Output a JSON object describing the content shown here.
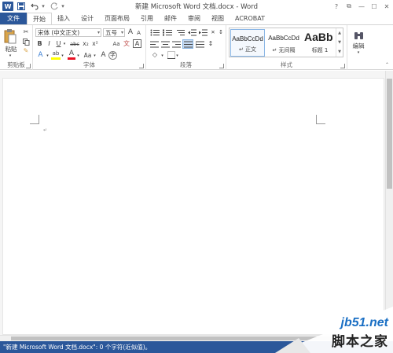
{
  "app": {
    "title": "新建 Microsoft Word 文档.docx - Word",
    "logo_letter": "W"
  },
  "quick_access": {
    "save_icon": "save-icon",
    "undo_icon": "undo-icon",
    "redo_icon": "redo-icon"
  },
  "window_controls": [
    "?",
    "⧉",
    "—",
    "☐",
    "✕"
  ],
  "tabs": [
    {
      "label": "文件"
    },
    {
      "label": "开始"
    },
    {
      "label": "插入"
    },
    {
      "label": "设计"
    },
    {
      "label": "页面布局"
    },
    {
      "label": "引用"
    },
    {
      "label": "邮件"
    },
    {
      "label": "审阅"
    },
    {
      "label": "视图"
    },
    {
      "label": "ACROBAT"
    }
  ],
  "ribbon": {
    "clipboard": {
      "label": "剪贴板",
      "paste_label": "粘贴"
    },
    "font": {
      "label": "字体",
      "font_name": "宋体 (中文正文)",
      "font_size": "五号",
      "grow": "A",
      "shrink": "A",
      "case": "Aa",
      "clear": "A",
      "wen": "文",
      "big_a": "A",
      "bold": "B",
      "italic": "I",
      "underline": "U",
      "strike": "abc",
      "sub": "x₂",
      "sup": "x²",
      "effects": "A",
      "highlight": "ab",
      "color": "A",
      "size_toggle": "Aa",
      "circle_char": "字"
    },
    "paragraph": {
      "label": "段落"
    },
    "styles": {
      "label": "样式",
      "items": [
        {
          "preview": "AaBbCcDd",
          "name": "↵ 正文"
        },
        {
          "preview": "AaBbCcDd",
          "name": "↵ 无间隔"
        },
        {
          "preview": "AaBb",
          "name": "标题 1"
        }
      ]
    },
    "editing": {
      "label": "编辑"
    }
  },
  "document": {
    "paragraph_mark": "↵"
  },
  "status": {
    "text": "\"新建 Microsoft Word 文档.docx\": 0 个字符(近似值)。"
  },
  "watermark": {
    "url": "jb51.net",
    "name": "脚本之家"
  },
  "colors": {
    "accent": "#2b579a",
    "highlight_yellow": "#ffff00",
    "font_red": "#e81123",
    "watermark_blue": "#1a6fc4"
  }
}
